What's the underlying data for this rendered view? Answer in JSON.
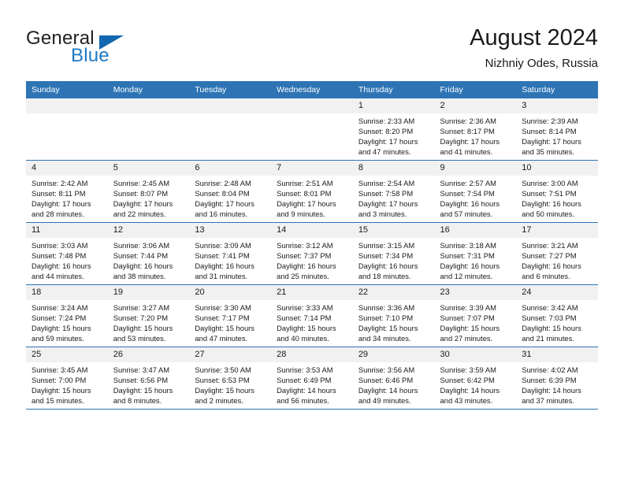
{
  "brand": {
    "word_one": "General",
    "word_two": "Blue",
    "logo_icon": "triangle-logo-icon",
    "accent_color": "#1368b0",
    "text_color": "#231f20"
  },
  "header": {
    "title": "August 2024",
    "subtitle": "Nizhniy Odes, Russia"
  },
  "calendar": {
    "header_bg": "#2e74b5",
    "daynum_bg": "#f1f1f1",
    "weekdays": [
      "Sunday",
      "Monday",
      "Tuesday",
      "Wednesday",
      "Thursday",
      "Friday",
      "Saturday"
    ],
    "weeks": [
      [
        {
          "empty": true
        },
        {
          "empty": true
        },
        {
          "empty": true
        },
        {
          "empty": true
        },
        {
          "day": "1",
          "sunrise": "Sunrise: 2:33 AM",
          "sunset": "Sunset: 8:20 PM",
          "daylight_1": "Daylight: 17 hours",
          "daylight_2": "and 47 minutes."
        },
        {
          "day": "2",
          "sunrise": "Sunrise: 2:36 AM",
          "sunset": "Sunset: 8:17 PM",
          "daylight_1": "Daylight: 17 hours",
          "daylight_2": "and 41 minutes."
        },
        {
          "day": "3",
          "sunrise": "Sunrise: 2:39 AM",
          "sunset": "Sunset: 8:14 PM",
          "daylight_1": "Daylight: 17 hours",
          "daylight_2": "and 35 minutes."
        }
      ],
      [
        {
          "day": "4",
          "sunrise": "Sunrise: 2:42 AM",
          "sunset": "Sunset: 8:11 PM",
          "daylight_1": "Daylight: 17 hours",
          "daylight_2": "and 28 minutes."
        },
        {
          "day": "5",
          "sunrise": "Sunrise: 2:45 AM",
          "sunset": "Sunset: 8:07 PM",
          "daylight_1": "Daylight: 17 hours",
          "daylight_2": "and 22 minutes."
        },
        {
          "day": "6",
          "sunrise": "Sunrise: 2:48 AM",
          "sunset": "Sunset: 8:04 PM",
          "daylight_1": "Daylight: 17 hours",
          "daylight_2": "and 16 minutes."
        },
        {
          "day": "7",
          "sunrise": "Sunrise: 2:51 AM",
          "sunset": "Sunset: 8:01 PM",
          "daylight_1": "Daylight: 17 hours",
          "daylight_2": "and 9 minutes."
        },
        {
          "day": "8",
          "sunrise": "Sunrise: 2:54 AM",
          "sunset": "Sunset: 7:58 PM",
          "daylight_1": "Daylight: 17 hours",
          "daylight_2": "and 3 minutes."
        },
        {
          "day": "9",
          "sunrise": "Sunrise: 2:57 AM",
          "sunset": "Sunset: 7:54 PM",
          "daylight_1": "Daylight: 16 hours",
          "daylight_2": "and 57 minutes."
        },
        {
          "day": "10",
          "sunrise": "Sunrise: 3:00 AM",
          "sunset": "Sunset: 7:51 PM",
          "daylight_1": "Daylight: 16 hours",
          "daylight_2": "and 50 minutes."
        }
      ],
      [
        {
          "day": "11",
          "sunrise": "Sunrise: 3:03 AM",
          "sunset": "Sunset: 7:48 PM",
          "daylight_1": "Daylight: 16 hours",
          "daylight_2": "and 44 minutes."
        },
        {
          "day": "12",
          "sunrise": "Sunrise: 3:06 AM",
          "sunset": "Sunset: 7:44 PM",
          "daylight_1": "Daylight: 16 hours",
          "daylight_2": "and 38 minutes."
        },
        {
          "day": "13",
          "sunrise": "Sunrise: 3:09 AM",
          "sunset": "Sunset: 7:41 PM",
          "daylight_1": "Daylight: 16 hours",
          "daylight_2": "and 31 minutes."
        },
        {
          "day": "14",
          "sunrise": "Sunrise: 3:12 AM",
          "sunset": "Sunset: 7:37 PM",
          "daylight_1": "Daylight: 16 hours",
          "daylight_2": "and 25 minutes."
        },
        {
          "day": "15",
          "sunrise": "Sunrise: 3:15 AM",
          "sunset": "Sunset: 7:34 PM",
          "daylight_1": "Daylight: 16 hours",
          "daylight_2": "and 18 minutes."
        },
        {
          "day": "16",
          "sunrise": "Sunrise: 3:18 AM",
          "sunset": "Sunset: 7:31 PM",
          "daylight_1": "Daylight: 16 hours",
          "daylight_2": "and 12 minutes."
        },
        {
          "day": "17",
          "sunrise": "Sunrise: 3:21 AM",
          "sunset": "Sunset: 7:27 PM",
          "daylight_1": "Daylight: 16 hours",
          "daylight_2": "and 6 minutes."
        }
      ],
      [
        {
          "day": "18",
          "sunrise": "Sunrise: 3:24 AM",
          "sunset": "Sunset: 7:24 PM",
          "daylight_1": "Daylight: 15 hours",
          "daylight_2": "and 59 minutes."
        },
        {
          "day": "19",
          "sunrise": "Sunrise: 3:27 AM",
          "sunset": "Sunset: 7:20 PM",
          "daylight_1": "Daylight: 15 hours",
          "daylight_2": "and 53 minutes."
        },
        {
          "day": "20",
          "sunrise": "Sunrise: 3:30 AM",
          "sunset": "Sunset: 7:17 PM",
          "daylight_1": "Daylight: 15 hours",
          "daylight_2": "and 47 minutes."
        },
        {
          "day": "21",
          "sunrise": "Sunrise: 3:33 AM",
          "sunset": "Sunset: 7:14 PM",
          "daylight_1": "Daylight: 15 hours",
          "daylight_2": "and 40 minutes."
        },
        {
          "day": "22",
          "sunrise": "Sunrise: 3:36 AM",
          "sunset": "Sunset: 7:10 PM",
          "daylight_1": "Daylight: 15 hours",
          "daylight_2": "and 34 minutes."
        },
        {
          "day": "23",
          "sunrise": "Sunrise: 3:39 AM",
          "sunset": "Sunset: 7:07 PM",
          "daylight_1": "Daylight: 15 hours",
          "daylight_2": "and 27 minutes."
        },
        {
          "day": "24",
          "sunrise": "Sunrise: 3:42 AM",
          "sunset": "Sunset: 7:03 PM",
          "daylight_1": "Daylight: 15 hours",
          "daylight_2": "and 21 minutes."
        }
      ],
      [
        {
          "day": "25",
          "sunrise": "Sunrise: 3:45 AM",
          "sunset": "Sunset: 7:00 PM",
          "daylight_1": "Daylight: 15 hours",
          "daylight_2": "and 15 minutes."
        },
        {
          "day": "26",
          "sunrise": "Sunrise: 3:47 AM",
          "sunset": "Sunset: 6:56 PM",
          "daylight_1": "Daylight: 15 hours",
          "daylight_2": "and 8 minutes."
        },
        {
          "day": "27",
          "sunrise": "Sunrise: 3:50 AM",
          "sunset": "Sunset: 6:53 PM",
          "daylight_1": "Daylight: 15 hours",
          "daylight_2": "and 2 minutes."
        },
        {
          "day": "28",
          "sunrise": "Sunrise: 3:53 AM",
          "sunset": "Sunset: 6:49 PM",
          "daylight_1": "Daylight: 14 hours",
          "daylight_2": "and 56 minutes."
        },
        {
          "day": "29",
          "sunrise": "Sunrise: 3:56 AM",
          "sunset": "Sunset: 6:46 PM",
          "daylight_1": "Daylight: 14 hours",
          "daylight_2": "and 49 minutes."
        },
        {
          "day": "30",
          "sunrise": "Sunrise: 3:59 AM",
          "sunset": "Sunset: 6:42 PM",
          "daylight_1": "Daylight: 14 hours",
          "daylight_2": "and 43 minutes."
        },
        {
          "day": "31",
          "sunrise": "Sunrise: 4:02 AM",
          "sunset": "Sunset: 6:39 PM",
          "daylight_1": "Daylight: 14 hours",
          "daylight_2": "and 37 minutes."
        }
      ]
    ]
  }
}
